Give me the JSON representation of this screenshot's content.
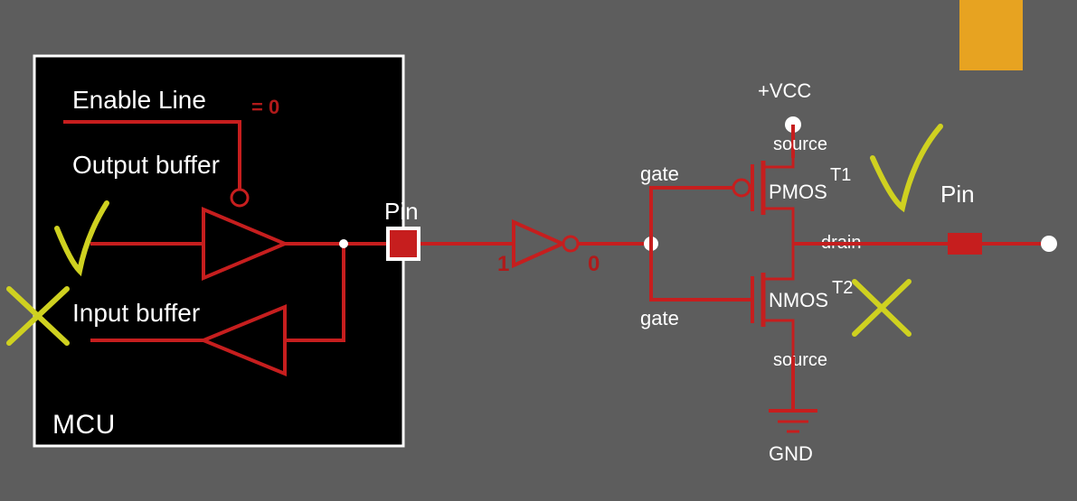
{
  "mcu": {
    "title": "MCU",
    "enable_line_label": "Enable Line",
    "enable_value": "= 0",
    "output_buffer_label": "Output buffer",
    "input_buffer_label": "Input buffer",
    "pin_label": "Pin"
  },
  "inverter": {
    "in_value": "1",
    "out_value": "0"
  },
  "cmos": {
    "vcc_label": "+VCC",
    "gnd_label": "GND",
    "gate_label_top": "gate",
    "gate_label_bot": "gate",
    "source_label_top": "source",
    "source_label_bot": "source",
    "drain_label": "drain",
    "pmos_label": "PMOS",
    "nmos_label": "NMOS",
    "t1_label": "T1",
    "t2_label": "T2",
    "pin_label": "Pin"
  },
  "accent": {
    "orange": "#e7a321"
  }
}
